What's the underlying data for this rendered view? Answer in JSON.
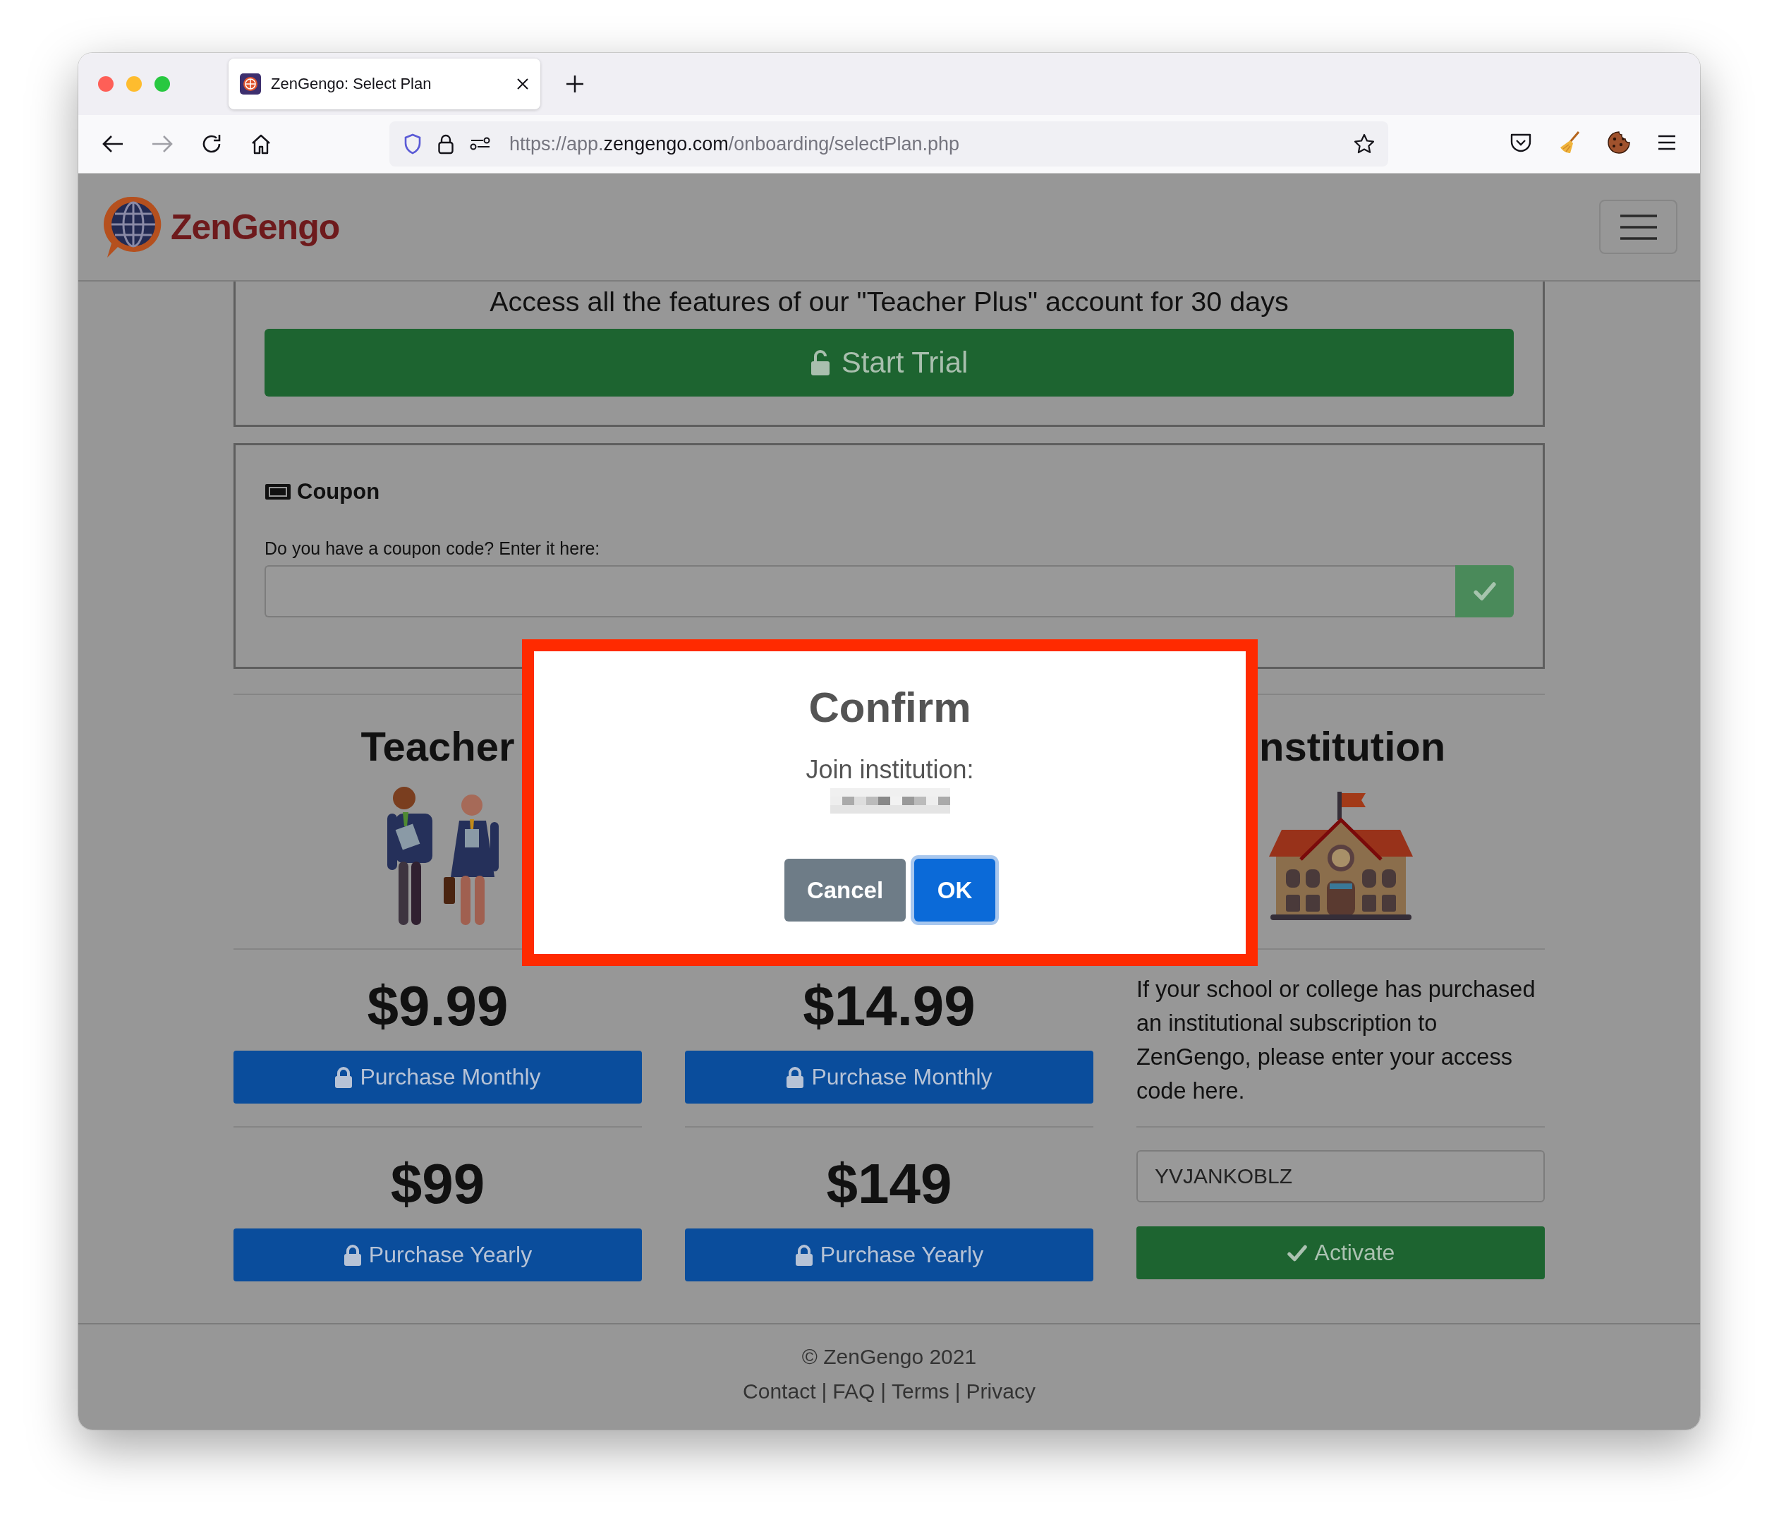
{
  "browser": {
    "tab_title": "ZenGengo: Select Plan",
    "url": {
      "scheme": "https://app.",
      "domain": "zengengo.com",
      "path": "/onboarding/selectPlan.php"
    }
  },
  "navbar": {
    "brand": "ZenGengo"
  },
  "trial": {
    "text": "Access all the features of our \"Teacher Plus\" account for 30 days",
    "button": "Start Trial"
  },
  "coupon": {
    "title": "Coupon",
    "prompt": "Do you have a coupon code? Enter it here:"
  },
  "columns": [
    {
      "kind": "plan",
      "heading": "Teacher",
      "illustration": {
        "kind": "people"
      },
      "monthly_price": "$9.99",
      "monthly_button": "Purchase Monthly",
      "yearly_price": "$99",
      "yearly_button": "Purchase Yearly"
    },
    {
      "kind": "plan",
      "monthly_price": "$14.99",
      "monthly_button": "Purchase Monthly",
      "yearly_price": "$149",
      "yearly_button": "Purchase Yearly"
    },
    {
      "kind": "institution",
      "heading": "nstitution",
      "illustration": {
        "kind": "school"
      },
      "text": "If your school or college has purchased an institutional subscription to ZenGengo, please enter your access code here.",
      "code": "YVJANKOBLZ",
      "button": "Activate"
    }
  ],
  "footer": {
    "copyright": "© ZenGengo 2021",
    "links": [
      "Contact",
      "FAQ",
      "Terms",
      "Privacy"
    ],
    "separator": "|"
  },
  "dialog": {
    "title": "Confirm",
    "message": "Join institution:",
    "buttons": [
      {
        "label": "Cancel",
        "kind": "secondary",
        "focused": false
      },
      {
        "label": "OK",
        "kind": "primary",
        "focused": true
      }
    ]
  }
}
